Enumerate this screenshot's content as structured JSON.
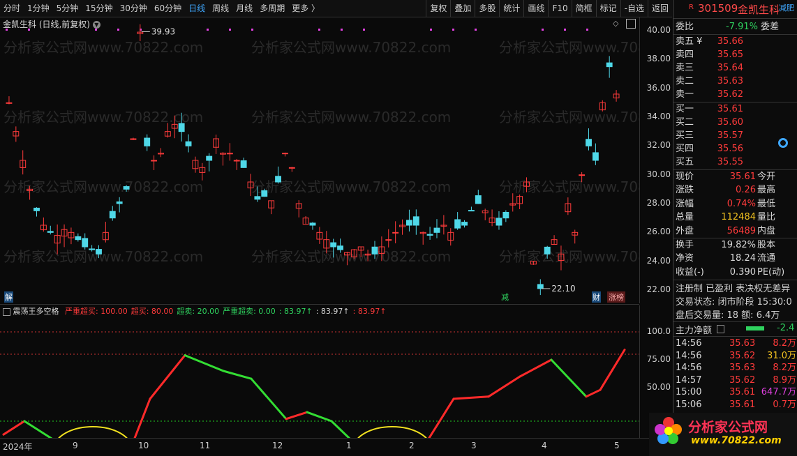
{
  "toolbar": {
    "periods": [
      "分时",
      "1分钟",
      "5分钟",
      "15分钟",
      "30分钟",
      "60分钟",
      "日线",
      "周线",
      "月线",
      "多周期",
      "更多 〉"
    ],
    "active_period": "日线",
    "tools": [
      "复权",
      "叠加",
      "多股",
      "统计",
      "画线",
      "F10",
      "简框",
      "标记",
      "-自选",
      "返回"
    ]
  },
  "chart": {
    "title": "金凯生科 (日线,前复权)",
    "max_label": "39.93",
    "min_label": "22.10",
    "markers": {
      "jie": "解",
      "jian": "减",
      "cai": "财",
      "zhangbang": "涨榜"
    },
    "watermark_text": "分析家公式网www.70822.com"
  },
  "main_axis": {
    "ticks": [
      "40.00",
      "38.00",
      "36.00",
      "34.00",
      "32.00",
      "30.00",
      "28.00",
      "26.00",
      "24.00",
      "22.00"
    ]
  },
  "osc": {
    "name": "震荡王多空格",
    "legend": [
      {
        "text": "严重超买: 100.00",
        "color": "#ff3b3b"
      },
      {
        "text": "超买: 80.00",
        "color": "#ff3b3b"
      },
      {
        "text": "超卖: 20.00",
        "color": "#2fd35f"
      },
      {
        "text": "严重超卖: 0.00",
        "color": "#2fd35f"
      },
      {
        "text": ": 83.97↑",
        "color": "#2fd35f"
      },
      {
        "text": ": 83.97↑",
        "color": "#d8d8d8"
      },
      {
        "text": ": 83.97↑",
        "color": "#ff3b3b"
      }
    ],
    "ticks": [
      "100.0",
      "75.00",
      "50.00"
    ]
  },
  "xaxis": {
    "labels": [
      "2024年",
      "9",
      "10",
      "11",
      "12",
      "1",
      "2",
      "3",
      "4",
      "5"
    ]
  },
  "panel": {
    "code": "301509",
    "name": "金凯生科",
    "weibi_label": "委比",
    "weibi_value": "-7.91%",
    "weicha_label": "委差",
    "asks": [
      {
        "label": "卖五 ¥",
        "price": "35.66"
      },
      {
        "label": "卖四",
        "price": "35.65"
      },
      {
        "label": "卖三",
        "price": "35.64"
      },
      {
        "label": "卖二",
        "price": "35.63"
      },
      {
        "label": "卖一",
        "price": "35.62"
      }
    ],
    "bids": [
      {
        "label": "买一",
        "price": "35.61"
      },
      {
        "label": "买二",
        "price": "35.60"
      },
      {
        "label": "买三",
        "price": "35.57"
      },
      {
        "label": "买四",
        "price": "35.56"
      },
      {
        "label": "买五",
        "price": "35.55"
      }
    ],
    "side_tag": "减肥",
    "stats": [
      {
        "l": "现价",
        "v": "35.61",
        "r": "今开",
        "c": "red"
      },
      {
        "l": "涨跌",
        "v": "0.26",
        "r": "最高",
        "c": "red"
      },
      {
        "l": "涨幅",
        "v": "0.74%",
        "r": "最低",
        "c": "red"
      },
      {
        "l": "总量",
        "v": "112484",
        "r": "量比",
        "c": "yellow"
      },
      {
        "l": "外盘",
        "v": "56489",
        "r": "内盘",
        "c": "red"
      }
    ],
    "stats2": [
      {
        "l": "换手",
        "v": "19.82%",
        "r": "股本"
      },
      {
        "l": "净资",
        "v": "18.24",
        "r": "流通"
      },
      {
        "l": "收益(-)",
        "v": "0.390",
        "r": "PE(动)"
      }
    ],
    "info1": "注册制 已盈利 表决权无差异",
    "info2": "交易状态: 闭市阶段 15:30:0",
    "info3": "盘后交易量: 18  额: 6.4万",
    "main_flow_label": "主力净额",
    "main_flow_value": "-2.4",
    "trades": [
      {
        "t": "14:56",
        "p": "35.63",
        "q": "8.2万",
        "c": "red"
      },
      {
        "t": "14:56",
        "p": "35.62",
        "q": "31.0万",
        "c": "yellow"
      },
      {
        "t": "14:56",
        "p": "35.63",
        "q": "8.2万",
        "c": "red"
      },
      {
        "t": "14:57",
        "p": "35.62",
        "q": "8.9万",
        "c": "red"
      },
      {
        "t": "15:00",
        "p": "35.61",
        "q": "647.7万",
        "c": "magenta"
      },
      {
        "t": "15:06",
        "p": "35.61",
        "q": "0.7万",
        "c": "red"
      }
    ],
    "logo_text": "分析家公式网",
    "logo_url": "www.70822.com"
  }
}
